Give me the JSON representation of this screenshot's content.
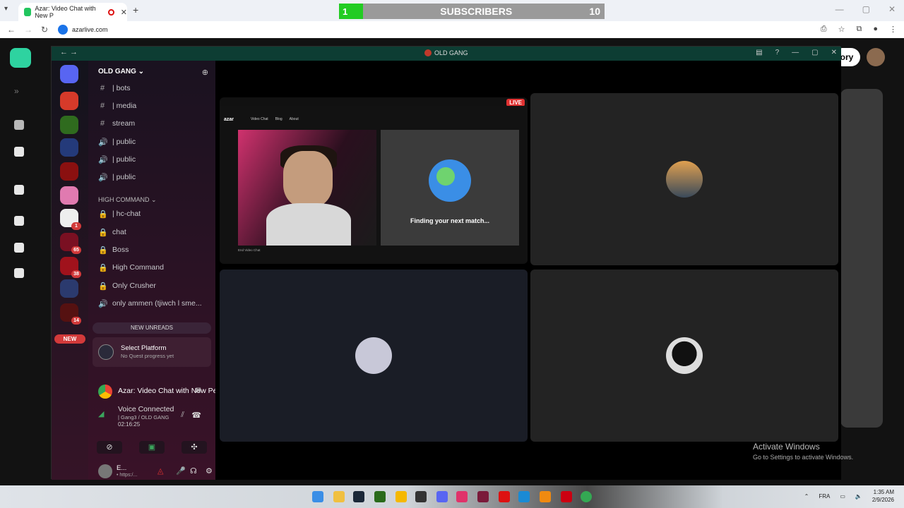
{
  "browser": {
    "tab_title": "Azar: Video Chat with New P",
    "url": "azarlive.com"
  },
  "overlay": {
    "count": "1",
    "label": "SUBSCRIBERS",
    "goal": "10"
  },
  "azar": {
    "story_label": "ory"
  },
  "discord": {
    "window_title": "OLD GANG",
    "server_name": "OLD GANG",
    "channels": [
      {
        "symbol": "#",
        "name": "| bots"
      },
      {
        "symbol": "#",
        "name": "| media"
      },
      {
        "symbol": "#",
        "name": "stream"
      },
      {
        "symbol": "🔊",
        "name": "| public"
      },
      {
        "symbol": "🔊",
        "name": "| public"
      },
      {
        "symbol": "🔊",
        "name": "| public"
      }
    ],
    "category": "HIGH COMMAND",
    "category_channels": [
      {
        "symbol": "🔒",
        "name": "| hc-chat"
      },
      {
        "symbol": "🔒",
        "name": "chat"
      },
      {
        "symbol": "🔒",
        "name": "Boss"
      },
      {
        "symbol": "🔒",
        "name": "High Command"
      },
      {
        "symbol": "🔒",
        "name": "Only Crusher"
      },
      {
        "symbol": "🔊",
        "name": "only ammen (tjiwch l sme..."
      }
    ],
    "guild_badges": [
      "1",
      "65",
      "38",
      "14"
    ],
    "new_pill": "NEW",
    "new_unreads": "NEW UNREADS",
    "quest_title": "Select Platform",
    "quest_sub": "No Quest progress yet",
    "activity": "Azar: Video Chat with New Pe...",
    "voice_status": "Voice Connected",
    "voice_channel": "| Gang3 / OLD GANG",
    "voice_time": "02:16:25",
    "user_name": "E...",
    "user_status": "• https:/..."
  },
  "stream": {
    "live_badge": "LIVE",
    "azar_logo": "azar",
    "nav": [
      "Video Chat",
      "Blog",
      "About"
    ],
    "finding_text": "Finding your next match...",
    "footer": "End Video Chat"
  },
  "watermark": {
    "title": "Activate Windows",
    "sub": "Go to Settings to activate Windows."
  },
  "taskbar": {
    "language": "FRA",
    "time": "1:35 AM",
    "date": "2/9/2026"
  }
}
